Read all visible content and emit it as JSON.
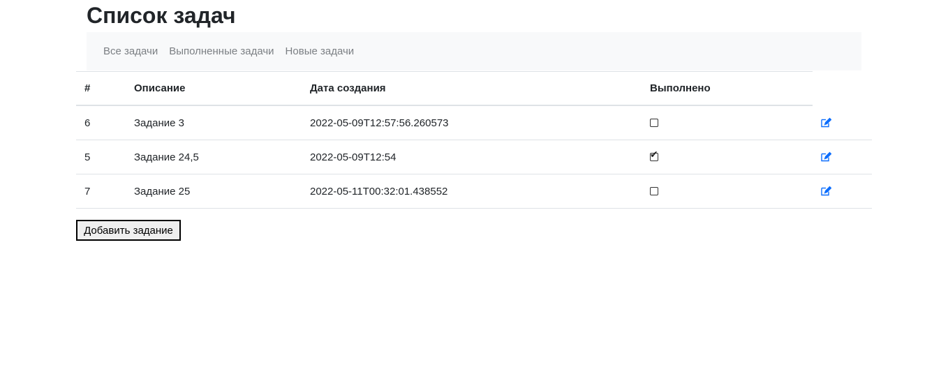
{
  "page": {
    "title": "Список задач"
  },
  "nav": {
    "items": [
      {
        "label": "Все задачи"
      },
      {
        "label": "Выполненные задачи"
      },
      {
        "label": "Новые задачи"
      }
    ]
  },
  "table": {
    "headers": {
      "id": "#",
      "description": "Описание",
      "created": "Дата создания",
      "done": "Выполнено"
    },
    "rows": [
      {
        "id": "6",
        "description": "Задание 3",
        "created": "2022-05-09T12:57:56.260573",
        "done": false
      },
      {
        "id": "5",
        "description": "Задание 24,5",
        "created": "2022-05-09T12:54",
        "done": true
      },
      {
        "id": "7",
        "description": "Задание 25",
        "created": "2022-05-11T00:32:01.438552",
        "done": false
      }
    ]
  },
  "actions": {
    "add_label": "Добавить задание"
  },
  "icons": {
    "edit": "edit-icon",
    "checkbox": "checkbox-icon"
  },
  "colors": {
    "accent": "#0d6efd",
    "nav_bg": "#f8f9fa",
    "nav_text": "#7b7f83",
    "border": "#dee2e6"
  }
}
